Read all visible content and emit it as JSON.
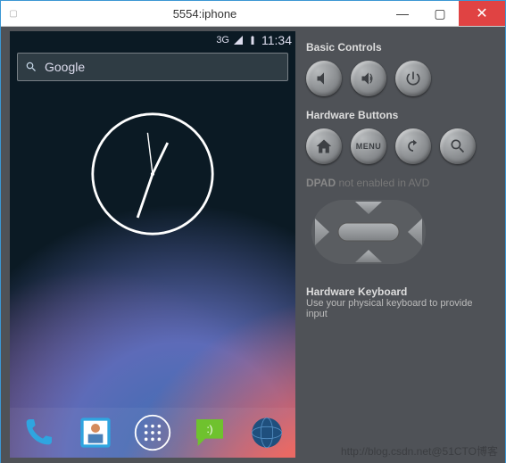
{
  "window": {
    "title": "5554:iphone"
  },
  "status": {
    "network_label": "3G",
    "time": "11:34"
  },
  "search": {
    "placeholder": "Google"
  },
  "side": {
    "basic_heading": "Basic Controls",
    "hw_heading": "Hardware Buttons",
    "menu_label": "MENU",
    "dpad_heading": "DPAD",
    "dpad_status": "not enabled in AVD",
    "kbd_heading": "Hardware Keyboard",
    "kbd_sub": "Use your physical keyboard to provide input"
  },
  "watermark": "http://blog.csdn.net@51CTO博客"
}
